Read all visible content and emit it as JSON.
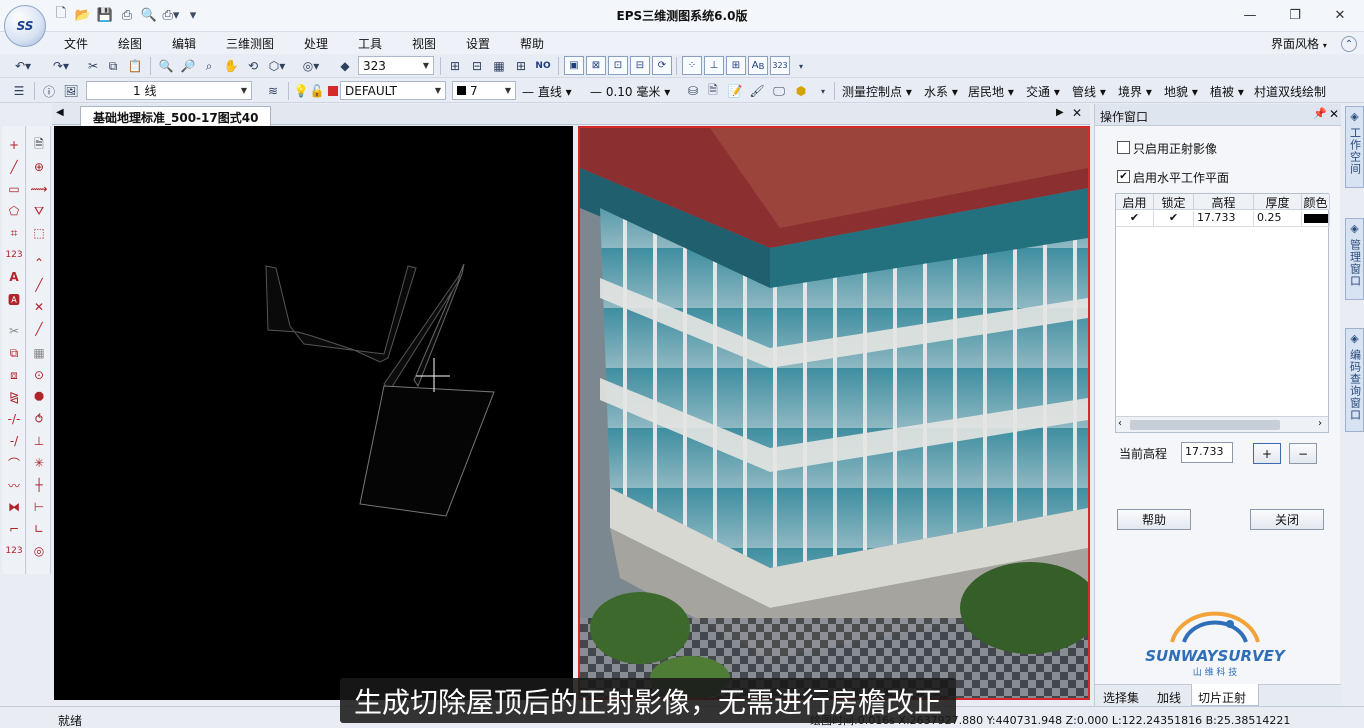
{
  "app": {
    "title": "EPS三维测图系统6.0版",
    "logo_text": "SS",
    "theme_label": "界面风格"
  },
  "menu": [
    "文件",
    "绘图",
    "编辑",
    "三维测图",
    "处理",
    "工具",
    "视图",
    "设置",
    "帮助"
  ],
  "toolbar1": {
    "scale_value": "323",
    "marker_label": "323"
  },
  "toolbar2": {
    "linetype_value": "1 线",
    "layer_value": "DEFAULT",
    "color_value": "7",
    "line_style_label": "直线",
    "line_width_label": "0.10 毫米",
    "categories": [
      "测量控制点",
      "水系",
      "居民地",
      "交通",
      "管线",
      "境界",
      "地貌",
      "植被",
      "村道双线绘制"
    ]
  },
  "document": {
    "tab_title": "基础地理标准_500-17图式40"
  },
  "panel": {
    "title": "操作窗口",
    "only_ortho_label": "只启用正射影像",
    "only_ortho_checked": false,
    "enable_plane_label": "启用水平工作平面",
    "enable_plane_checked": true,
    "table": {
      "headers": [
        "启用",
        "锁定",
        "高程",
        "厚度",
        "颜色"
      ],
      "rows": [
        {
          "enabled": "✔",
          "locked": "✔",
          "elevation": "17.733",
          "thickness": "0.25",
          "color": "#000000"
        }
      ]
    },
    "current_elevation_label": "当前高程",
    "current_elevation_value": "17.733",
    "plus_label": "+",
    "minus_label": "−",
    "help_label": "帮助",
    "close_label": "关闭",
    "tabs": [
      "选择集",
      "加线",
      "切片正射"
    ],
    "active_tab": "切片正射"
  },
  "dock_tabs": [
    "工作空间",
    "管理窗口",
    "编码查询窗口"
  ],
  "status": {
    "ready": "就绪",
    "coords": "绘图时间:0.016s  X:2637927.880 Y:440731.948 Z:0.000 L:122.24351816 B:25.38514221"
  },
  "subtitle": "生成切除屋顶后的正射影像，无需进行房檐改正",
  "watermark": {
    "brand": "SUNWAYSURVEY",
    "sub": "山 维 科 技"
  },
  "colors": {
    "viewport_border": "#d42a2a",
    "accent": "#1d3f8f"
  }
}
